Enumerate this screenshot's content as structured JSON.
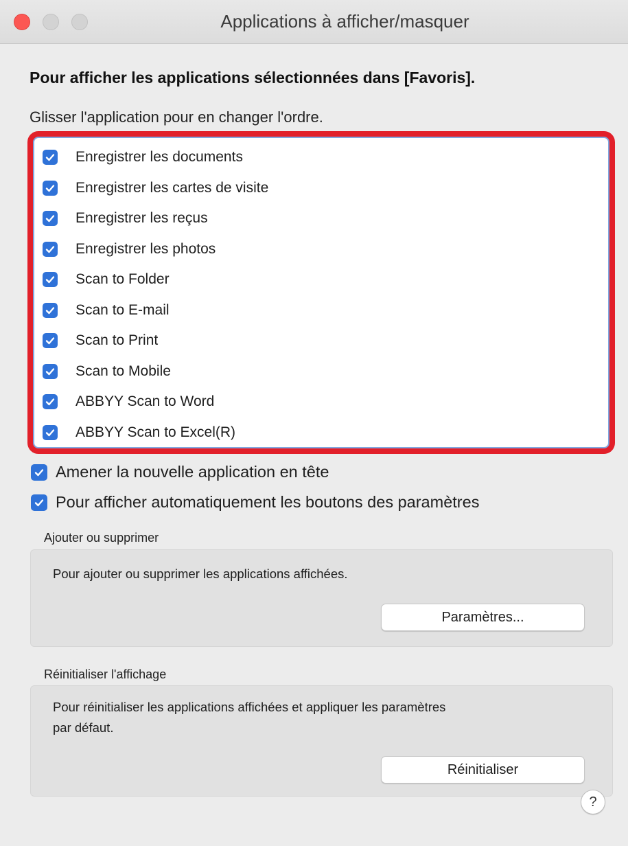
{
  "window": {
    "title": "Applications à afficher/masquer"
  },
  "heading": "Pour afficher les applications sélectionnées dans [Favoris].",
  "subheading": "Glisser l'application pour en changer l'ordre.",
  "apps": [
    {
      "label": "Enregistrer les documents",
      "checked": true
    },
    {
      "label": "Enregistrer les cartes de visite",
      "checked": true
    },
    {
      "label": "Enregistrer les reçus",
      "checked": true
    },
    {
      "label": "Enregistrer les photos",
      "checked": true
    },
    {
      "label": "Scan to Folder",
      "checked": true
    },
    {
      "label": "Scan to E-mail",
      "checked": true
    },
    {
      "label": "Scan to Print",
      "checked": true
    },
    {
      "label": "Scan to Mobile",
      "checked": true
    },
    {
      "label": "ABBYY Scan to Word",
      "checked": true
    },
    {
      "label": "ABBYY Scan to Excel(R)",
      "checked": true
    }
  ],
  "options": {
    "new_app_top": {
      "label": "Amener la nouvelle application en tête",
      "checked": true
    },
    "auto_show_settings": {
      "label": "Pour afficher automatiquement les boutons des paramètres",
      "checked": true
    }
  },
  "add_remove": {
    "title": "Ajouter ou supprimer",
    "text": "Pour ajouter ou supprimer les applications affichées.",
    "button": "Paramètres..."
  },
  "reset": {
    "title": "Réinitialiser l'affichage",
    "text_line1": "Pour réinitialiser les applications affichées et appliquer les paramètres",
    "text_line2": "par défaut.",
    "button": "Réinitialiser"
  },
  "help": {
    "label": "?"
  },
  "colors": {
    "accent": "#2f72d8",
    "highlight": "#e2202a",
    "close": "#fc5753"
  }
}
